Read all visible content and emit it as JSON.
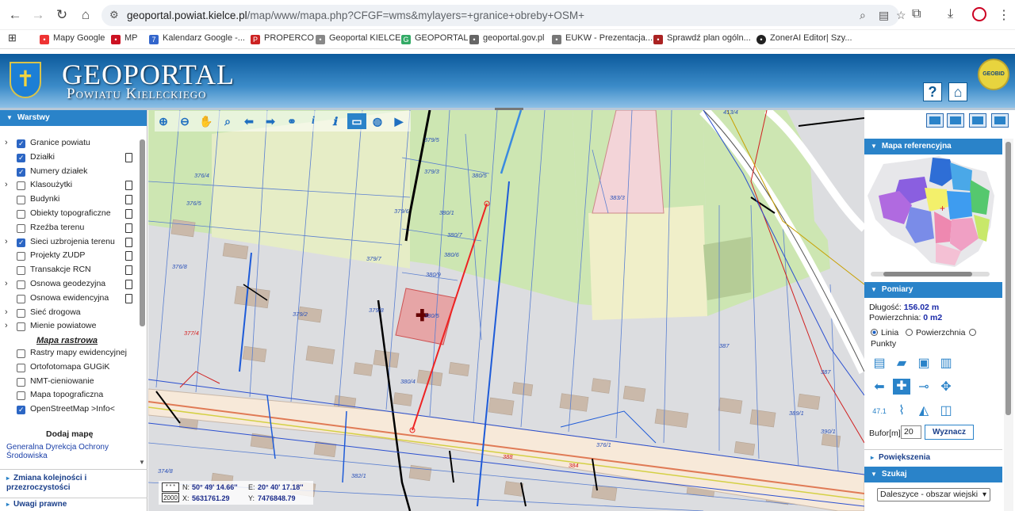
{
  "browser": {
    "url_domain": "geoportal.powiat.kielce.pl",
    "url_path": "/map/www/mapa.php?CFGF=wms&mylayers=+granice+obreby+OSM+",
    "bookmarks": [
      "Mapy Google",
      "MP",
      "Kalendarz Google -...",
      "PROPERCO",
      "Geoportal KIELCE",
      "GEOPORTAL",
      "geoportal.gov.pl",
      "EUKW - Prezentacja...",
      "Sprawdź plan ogóln...",
      "ZonerAI Editor| Szy..."
    ]
  },
  "header": {
    "title": "GEOPORTAL",
    "subtitle": "Powiatu Kieleckiego",
    "help_label": "?",
    "badge": "GEOBID"
  },
  "layers_panel": {
    "title": "Warstwy",
    "layers": [
      {
        "label": "Granice powiatu",
        "checked": true,
        "expandable": true,
        "doc": false
      },
      {
        "label": "Działki",
        "checked": true,
        "expandable": false,
        "doc": true
      },
      {
        "label": "Numery działek",
        "checked": true,
        "expandable": false,
        "doc": false
      },
      {
        "label": "Klasoużytki",
        "checked": false,
        "expandable": true,
        "doc": true
      },
      {
        "label": "Budynki",
        "checked": false,
        "expandable": false,
        "doc": true
      },
      {
        "label": "Obiekty topograficzne",
        "checked": false,
        "expandable": false,
        "doc": true
      },
      {
        "label": "Rzeźba terenu",
        "checked": false,
        "expandable": false,
        "doc": true
      },
      {
        "label": "Sieci uzbrojenia terenu",
        "checked": true,
        "expandable": true,
        "doc": true
      },
      {
        "label": "Projekty ZUDP",
        "checked": false,
        "expandable": false,
        "doc": true
      },
      {
        "label": "Transakcje RCN",
        "checked": false,
        "expandable": false,
        "doc": true
      },
      {
        "label": "Osnowa geodezyjna",
        "checked": false,
        "expandable": true,
        "doc": true
      },
      {
        "label": "Osnowa ewidencyjna",
        "checked": false,
        "expandable": false,
        "doc": true
      },
      {
        "label": "Sieć drogowa",
        "checked": false,
        "expandable": true,
        "doc": false
      },
      {
        "label": "Mienie powiatowe",
        "checked": false,
        "expandable": true,
        "doc": false
      }
    ],
    "raster_title": "Mapa rastrowa",
    "raster_layers": [
      {
        "label": "Rastry mapy ewidencyjnej",
        "checked": false
      },
      {
        "label": "Ortofotomapa GUGiK",
        "checked": false
      },
      {
        "label": "NMT-cieniowanie",
        "checked": false
      },
      {
        "label": "Mapa topograficzna",
        "checked": false
      },
      {
        "label": "OpenStreetMap >Info<",
        "checked": true
      }
    ],
    "add_map": "Dodaj mapę",
    "gdos_link": "Generalna Dyrekcja Ochrony Środowiska",
    "accordion": [
      "Zmiana kolejności i przezroczystości",
      "Uwagi prawne"
    ]
  },
  "map": {
    "parcels": [
      "379/5",
      "376/4",
      "376/5",
      "379/3",
      "380/5",
      "379/6",
      "380/1",
      "380/7",
      "379/7",
      "380/6",
      "380/9",
      "376/8",
      "379/2",
      "379/8",
      "377/4",
      "380/5",
      "380/4",
      "383/3",
      "387",
      "389/1",
      "390/1",
      "387",
      "384",
      "388",
      "374/8",
      "382/1",
      "376/1",
      "413/4"
    ],
    "coords": {
      "scale_icon": "* * *",
      "scale_value": "2000",
      "n_label": "N:",
      "n_value": "50° 49' 14.66''",
      "e_label": "E:",
      "e_value": "20° 40' 17.18''",
      "x_label": "X:",
      "x_value": "5631761.29",
      "y_label": "Y:",
      "y_value": "7476848.79"
    }
  },
  "right_panel": {
    "ref_title": "Mapa referencyjna",
    "measure_title": "Pomiary",
    "length_label": "Długość:",
    "length_value": "156.02 m",
    "area_label": "Powierzchnia:",
    "area_value": "0 m2",
    "mode_line": "Linia",
    "mode_area": "Powierzchnia",
    "mode_points": "Punkty",
    "bufor_label": "Bufor[m]",
    "bufor_value": "20",
    "bufor_button": "Wyznacz",
    "zoom_title": "Powiększenia",
    "search_title": "Szukaj",
    "search_select": "Daleszyce - obszar wiejski"
  }
}
